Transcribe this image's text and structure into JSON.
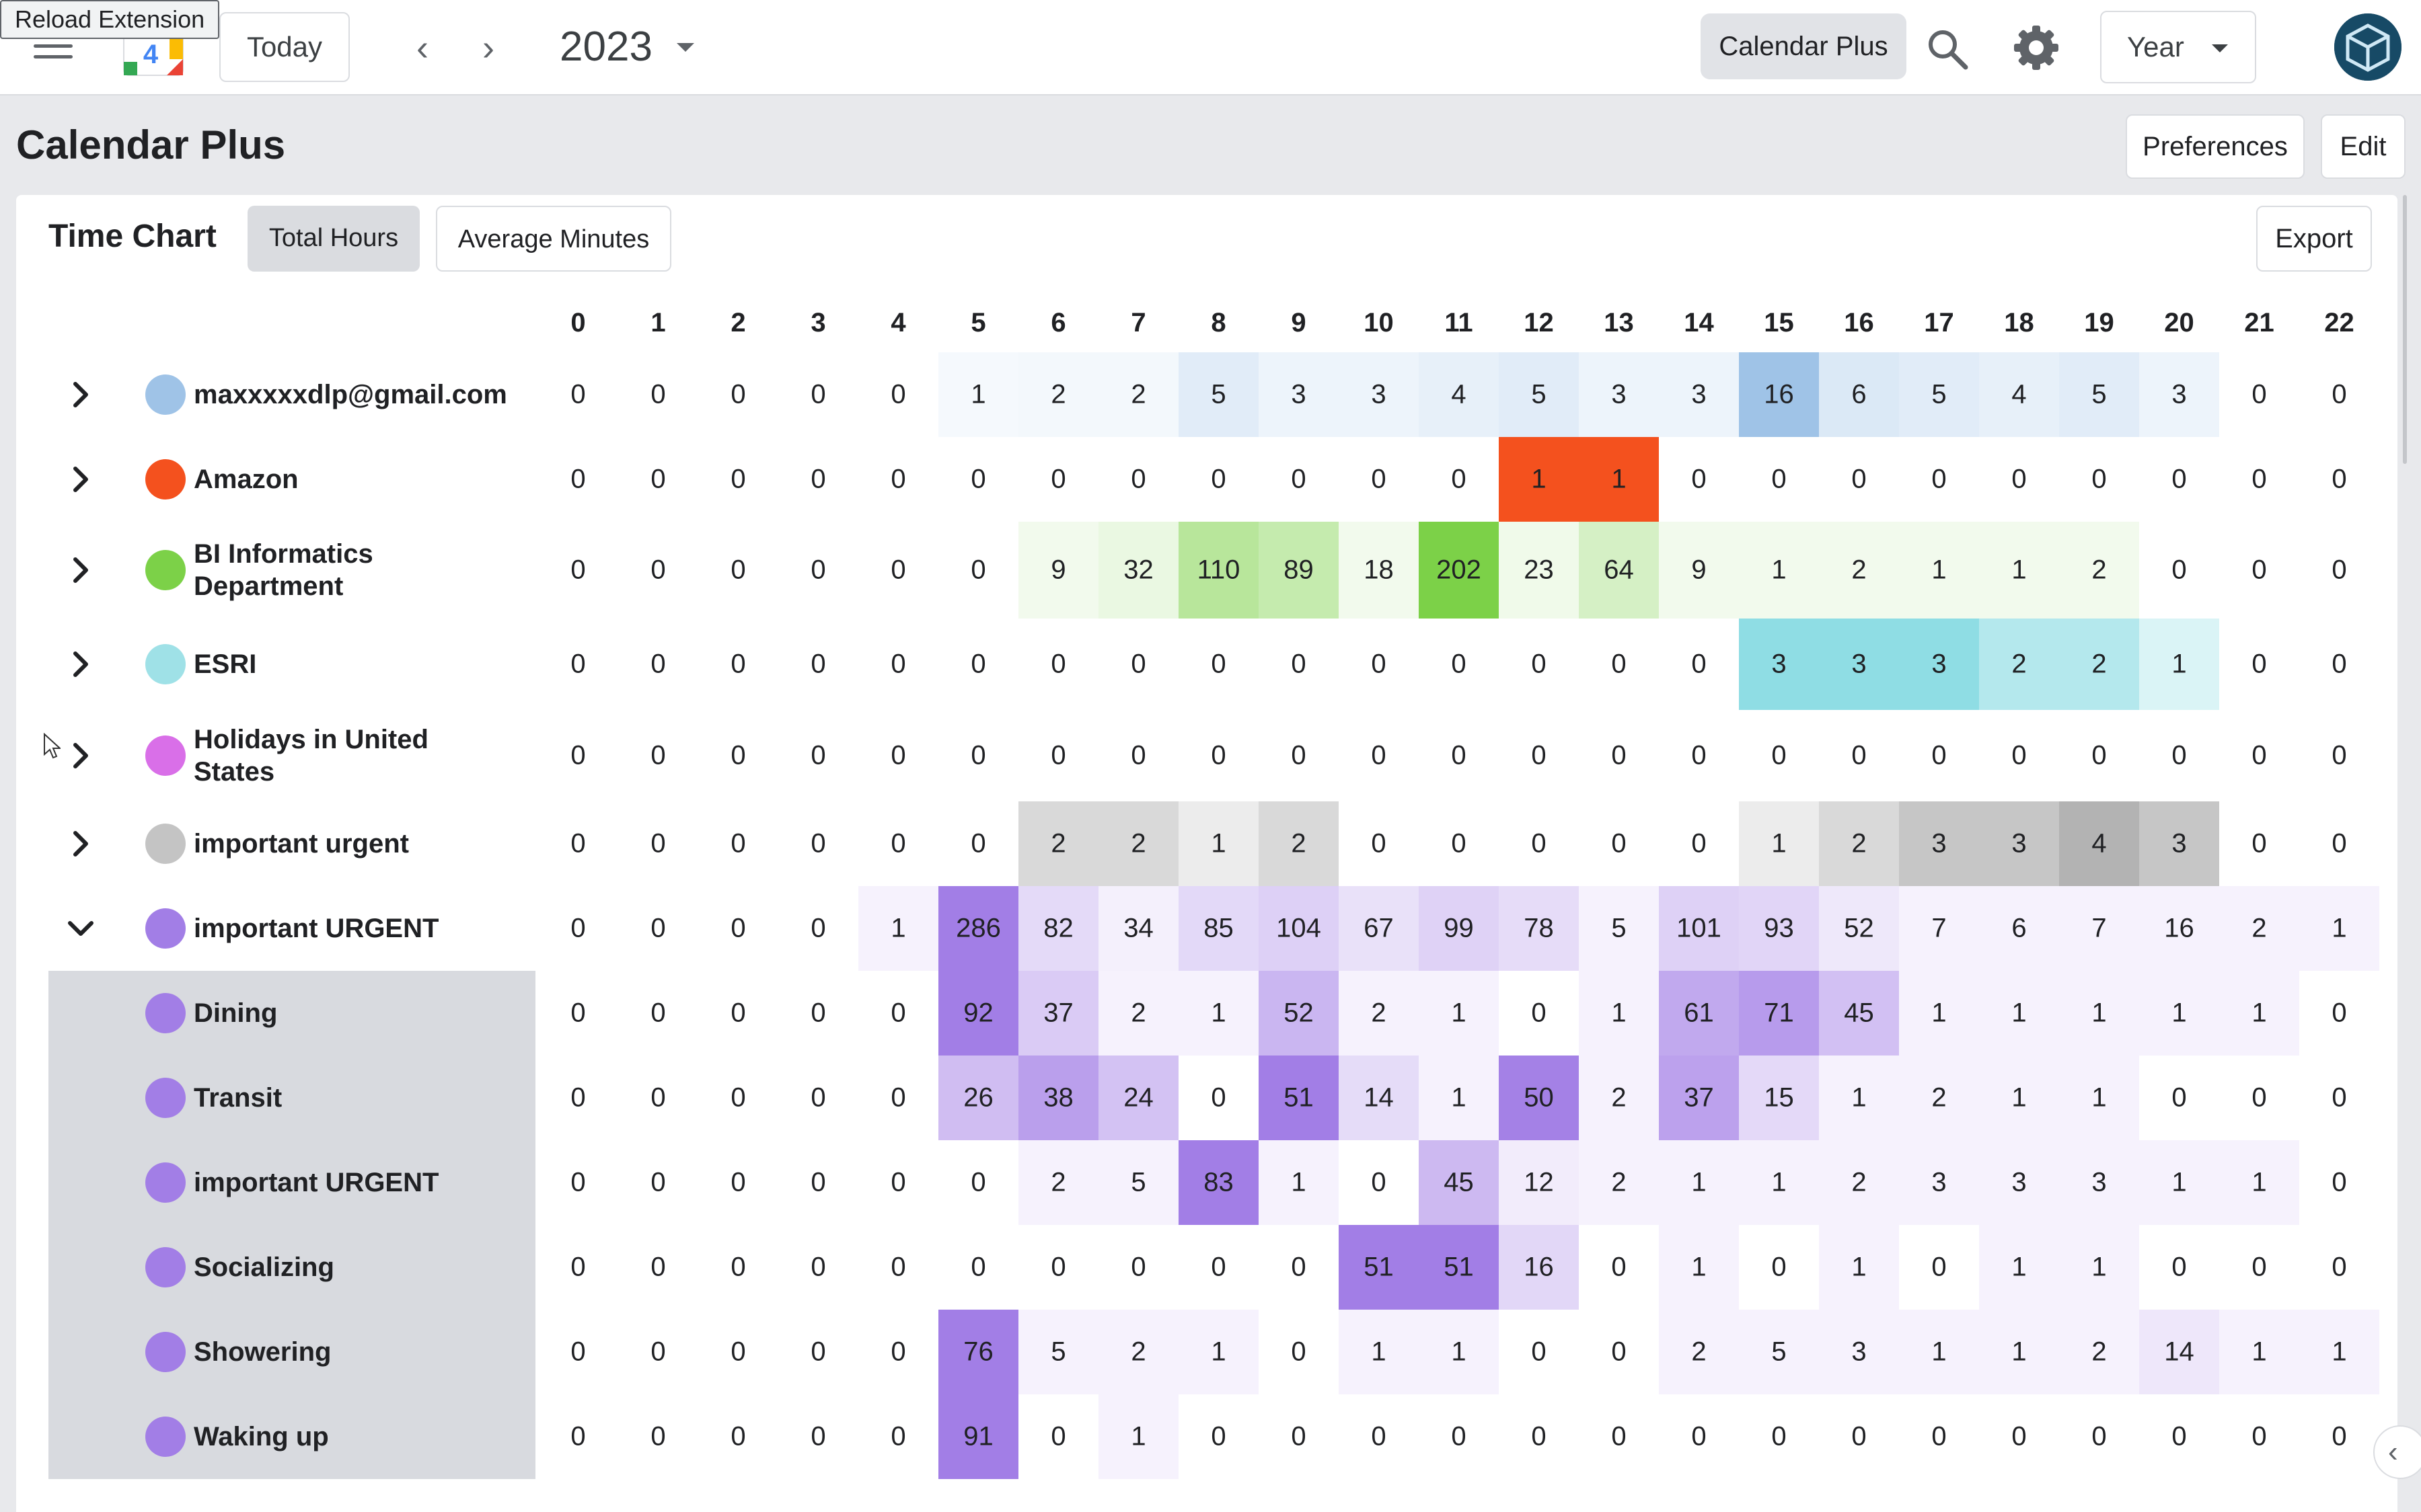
{
  "topbar": {
    "reload_label": "Reload Extension",
    "today_label": "Today",
    "prev_glyph": "‹",
    "next_glyph": "›",
    "year": "2023",
    "calendar_plus_label": "Calendar Plus",
    "view_label": "Year",
    "logo_day": "4"
  },
  "header": {
    "title": "Calendar Plus",
    "preferences_label": "Preferences",
    "edit_label": "Edit"
  },
  "chart": {
    "title": "Time Chart",
    "total_hours_label": "Total Hours",
    "average_minutes_label": "Average Minutes",
    "export_label": "Export",
    "hours": [
      "0",
      "1",
      "2",
      "3",
      "4",
      "5",
      "6",
      "7",
      "8",
      "9",
      "10",
      "11",
      "12",
      "13",
      "14",
      "15",
      "16",
      "17",
      "18",
      "19",
      "20",
      "21",
      "22"
    ]
  },
  "rows": [
    {
      "label": "maxxxxxdlp@gmail.com",
      "color": "#9fc3e7",
      "expander": "collapsed",
      "sub": false,
      "values": [
        0,
        0,
        0,
        0,
        0,
        1,
        2,
        2,
        5,
        3,
        3,
        4,
        5,
        3,
        3,
        16,
        6,
        5,
        4,
        5,
        3,
        0,
        0
      ]
    },
    {
      "label": "Amazon",
      "color": "#f4511e",
      "expander": "collapsed",
      "sub": false,
      "values": [
        0,
        0,
        0,
        0,
        0,
        0,
        0,
        0,
        0,
        0,
        0,
        0,
        1,
        1,
        0,
        0,
        0,
        0,
        0,
        0,
        0,
        0,
        0
      ]
    },
    {
      "label": "BI Informatics Department",
      "color": "#7cd148",
      "expander": "collapsed",
      "sub": false,
      "values": [
        0,
        0,
        0,
        0,
        0,
        0,
        9,
        32,
        110,
        89,
        18,
        202,
        23,
        64,
        9,
        1,
        2,
        1,
        1,
        2,
        0,
        0,
        0
      ]
    },
    {
      "label": "ESRI",
      "color": "#9fe1e7",
      "expander": "collapsed",
      "sub": false,
      "values": [
        0,
        0,
        0,
        0,
        0,
        0,
        0,
        0,
        0,
        0,
        0,
        0,
        0,
        0,
        0,
        3,
        3,
        3,
        2,
        2,
        1,
        0,
        0
      ]
    },
    {
      "label": "Holidays in United States",
      "color": "#d96fe8",
      "expander": "collapsed",
      "sub": false,
      "values": [
        0,
        0,
        0,
        0,
        0,
        0,
        0,
        0,
        0,
        0,
        0,
        0,
        0,
        0,
        0,
        0,
        0,
        0,
        0,
        0,
        0,
        0,
        0
      ]
    },
    {
      "label": "important urgent",
      "color": "#c4c4c4",
      "expander": "collapsed",
      "sub": false,
      "values": [
        0,
        0,
        0,
        0,
        0,
        0,
        2,
        2,
        1,
        2,
        0,
        0,
        0,
        0,
        0,
        1,
        2,
        3,
        3,
        4,
        3,
        0,
        0
      ]
    },
    {
      "label": "important URGENT",
      "color": "#a27ee6",
      "expander": "expanded",
      "sub": false,
      "values": [
        0,
        0,
        0,
        0,
        1,
        286,
        82,
        34,
        85,
        104,
        67,
        99,
        78,
        5,
        101,
        93,
        52,
        7,
        6,
        7,
        16,
        2,
        1
      ]
    },
    {
      "label": "Dining",
      "color": "#a27ee6",
      "expander": "none",
      "sub": true,
      "values": [
        0,
        0,
        0,
        0,
        0,
        92,
        37,
        2,
        1,
        52,
        2,
        1,
        0,
        1,
        61,
        71,
        45,
        1,
        1,
        1,
        1,
        1,
        0
      ]
    },
    {
      "label": "Transit",
      "color": "#a27ee6",
      "expander": "none",
      "sub": true,
      "values": [
        0,
        0,
        0,
        0,
        0,
        26,
        38,
        24,
        0,
        51,
        14,
        1,
        50,
        2,
        37,
        15,
        1,
        2,
        1,
        1,
        0,
        0,
        0
      ]
    },
    {
      "label": "important URGENT",
      "color": "#a27ee6",
      "expander": "none",
      "sub": true,
      "values": [
        0,
        0,
        0,
        0,
        0,
        0,
        2,
        5,
        83,
        1,
        0,
        45,
        12,
        2,
        1,
        1,
        2,
        3,
        3,
        3,
        1,
        1,
        0
      ]
    },
    {
      "label": "Socializing",
      "color": "#a27ee6",
      "expander": "none",
      "sub": true,
      "values": [
        0,
        0,
        0,
        0,
        0,
        0,
        0,
        0,
        0,
        0,
        51,
        51,
        16,
        0,
        1,
        0,
        1,
        0,
        1,
        1,
        0,
        0,
        0
      ]
    },
    {
      "label": "Showering",
      "color": "#a27ee6",
      "expander": "none",
      "sub": true,
      "values": [
        0,
        0,
        0,
        0,
        0,
        76,
        5,
        2,
        1,
        0,
        1,
        1,
        0,
        0,
        2,
        5,
        3,
        1,
        1,
        2,
        14,
        1,
        1
      ]
    },
    {
      "label": "Waking up",
      "color": "#a27ee6",
      "expander": "none",
      "sub": true,
      "values": [
        0,
        0,
        0,
        0,
        0,
        91,
        0,
        1,
        0,
        0,
        0,
        0,
        0,
        0,
        0,
        0,
        0,
        0,
        0,
        0,
        0,
        0,
        0
      ]
    }
  ]
}
